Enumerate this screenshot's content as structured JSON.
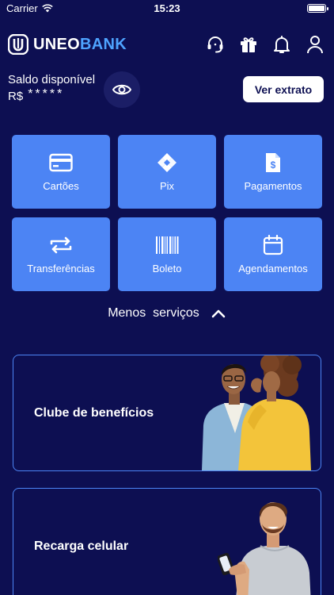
{
  "status_bar": {
    "carrier": "Carrier",
    "time": "15:23"
  },
  "header": {
    "brand_part1": "UNEO",
    "brand_part2": "BANK",
    "icons": [
      "headset-icon",
      "gift-icon",
      "bell-icon",
      "user-icon"
    ]
  },
  "balance": {
    "label": "Saldo disponível",
    "currency": "R$",
    "masked_value": "*****",
    "statement_button": "Ver extrato"
  },
  "services": [
    {
      "label": "Cartões",
      "icon": "card-icon"
    },
    {
      "label": "Pix",
      "icon": "pix-icon"
    },
    {
      "label": "Pagamentos",
      "icon": "invoice-icon"
    },
    {
      "label": "Transferências",
      "icon": "transfer-icon"
    },
    {
      "label": "Boleto",
      "icon": "barcode-icon"
    },
    {
      "label": "Agendamentos",
      "icon": "calendar-icon"
    }
  ],
  "toggle_services": {
    "label": "Menos  serviços"
  },
  "promo_cards": [
    {
      "title": "Clube de benefícios"
    },
    {
      "title": "Recarga celular"
    }
  ],
  "colors": {
    "background": "#0d0f52",
    "tile": "#4c84f4",
    "brand_accent": "#4ea3ff"
  }
}
